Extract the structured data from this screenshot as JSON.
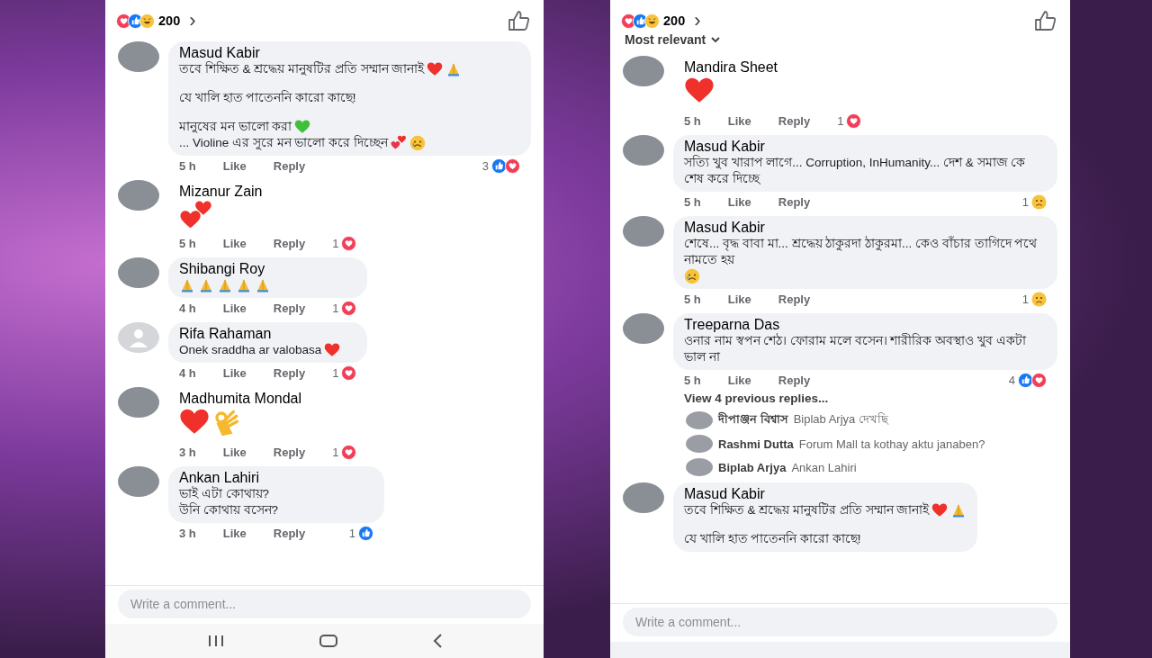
{
  "panels": [
    {
      "header": {
        "reactions": [
          {
            "kind": "love"
          },
          {
            "kind": "like"
          },
          {
            "kind": "haha"
          }
        ],
        "count": "200",
        "chevron": "›"
      },
      "comments": [
        {
          "author": "Masud Kabir",
          "bubble": true,
          "paragraphs": [
            [
              {
                "kind": "text",
                "text": "তবে শিক্ষিত & শ্রদ্ধেয় মানুষটির প্রতি সম্মান জানাই"
              },
              {
                "kind": "heart"
              },
              {
                "kind": "pray"
              }
            ],
            [
              {
                "kind": "text",
                "text": "যে খালি হাত পাতেননি কারো কাছে!"
              }
            ],
            [
              {
                "kind": "text",
                "text": "মানুষের মন ভালো করা"
              },
              {
                "kind": "green_heart"
              },
              {
                "kind": "text",
                "text": "... Violine এর সুরে মন ভালো করে দিচ্ছেন"
              },
              {
                "kind": "hearts"
              },
              {
                "kind": "sad"
              }
            ]
          ],
          "time": "5 h",
          "like": "Like",
          "reply": "Reply",
          "reactions": {
            "count": "3",
            "kinds": [
              {
                "kind": "like"
              },
              {
                "kind": "love"
              }
            ]
          }
        },
        {
          "author": "Mizanur Zain",
          "bubble": false,
          "paragraphs": [
            [
              {
                "kind": "hearts_big"
              }
            ]
          ],
          "time": "5 h",
          "like": "Like",
          "reply": "Reply",
          "reactions": {
            "count": "1",
            "kinds": [
              {
                "kind": "love"
              }
            ]
          }
        },
        {
          "author": "Shibangi Roy",
          "bubble": true,
          "paragraphs": [
            [
              {
                "kind": "pray"
              },
              {
                "kind": "pray"
              },
              {
                "kind": "pray"
              },
              {
                "kind": "pray"
              },
              {
                "kind": "pray"
              }
            ]
          ],
          "time": "4 h",
          "like": "Like",
          "reply": "Reply",
          "reactions": {
            "count": "1",
            "kinds": [
              {
                "kind": "love"
              }
            ]
          }
        },
        {
          "author": "Rifa Rahaman",
          "default_avatar": true,
          "bubble": true,
          "paragraphs": [
            [
              {
                "kind": "text",
                "text": "Onek sraddha ar valobasa"
              },
              {
                "kind": "heart"
              }
            ]
          ],
          "time": "4 h",
          "like": "Like",
          "reply": "Reply",
          "reactions": {
            "count": "1",
            "kinds": [
              {
                "kind": "love"
              }
            ]
          }
        },
        {
          "author": "Madhumita Mondal",
          "bubble": false,
          "paragraphs": [
            [
              {
                "kind": "heart_big"
              },
              {
                "kind": "ok_big"
              }
            ]
          ],
          "time": "3 h",
          "like": "Like",
          "reply": "Reply",
          "reactions": {
            "count": "1",
            "kinds": [
              {
                "kind": "love"
              }
            ]
          }
        },
        {
          "author": "Ankan Lahiri",
          "bubble": true,
          "paragraphs": [
            [
              {
                "kind": "text",
                "text": "ভাই এটা কোথায়?"
              },
              {
                "kind": "break"
              },
              {
                "kind": "text",
                "text": "উনি কোথায় বসেন?"
              }
            ]
          ],
          "time": "3 h",
          "like": "Like",
          "reply": "Reply",
          "reactions": {
            "count": "1",
            "kinds": [
              {
                "kind": "like"
              }
            ]
          }
        }
      ],
      "composer": {
        "placeholder": "Write a comment..."
      },
      "nav_bar": true
    },
    {
      "header": {
        "reactions": [
          {
            "kind": "love"
          },
          {
            "kind": "like"
          },
          {
            "kind": "haha"
          }
        ],
        "count": "200",
        "chevron": "›"
      },
      "sort_label": "Most relevant",
      "comments": [
        {
          "author": "Mandira Sheet",
          "bubble": false,
          "paragraphs": [
            [
              {
                "kind": "heart_big"
              }
            ]
          ],
          "time": "5 h",
          "like": "Like",
          "reply": "Reply",
          "reactions": {
            "count": "1",
            "kinds": [
              {
                "kind": "love"
              }
            ]
          }
        },
        {
          "author": "Masud Kabir",
          "bubble": true,
          "paragraphs": [
            [
              {
                "kind": "text",
                "text": "সত্যি খুব খারাপ লাগে... Corruption, InHumanity... দেশ & সমাজ কে শেষ করে দিচ্ছে"
              }
            ]
          ],
          "time": "5 h",
          "like": "Like",
          "reply": "Reply",
          "reactions": {
            "count": "1",
            "kinds": [
              {
                "kind": "sad"
              }
            ]
          }
        },
        {
          "author": "Masud Kabir",
          "bubble": true,
          "paragraphs": [
            [
              {
                "kind": "text",
                "text": "শেষে... বৃদ্ধ বাবা মা... শ্রদ্ধেয় ঠাকুরদা ঠাকুরমা... কেও বাঁচার তাগিদে পথে নামতে হয়"
              },
              {
                "kind": "sad"
              }
            ]
          ],
          "time": "5 h",
          "like": "Like",
          "reply": "Reply",
          "reactions": {
            "count": "1",
            "kinds": [
              {
                "kind": "sad"
              }
            ]
          }
        },
        {
          "author": "Treeparna Das",
          "bubble": true,
          "paragraphs": [
            [
              {
                "kind": "text",
                "text": "ওনার নাম স্বপন শেঠ। ফোরাম মলে বসেন। শারীরিক অবস্থাও খুব একটা ভাল না"
              }
            ]
          ],
          "time": "5 h",
          "like": "Like",
          "reply": "Reply",
          "reactions": {
            "count": "4",
            "kinds": [
              {
                "kind": "like"
              },
              {
                "kind": "love"
              }
            ]
          },
          "replies": {
            "view_more": "View 4 previous replies...",
            "items": [
              {
                "author": "দীপাঞ্জন বিশ্বাস",
                "text": "Biplab Arjya দেখছি"
              },
              {
                "author": "Rashmi Dutta",
                "text": "Forum Mall ta kothay aktu janaben?"
              },
              {
                "author": "Biplab Arjya",
                "text": "Ankan Lahiri"
              }
            ]
          }
        },
        {
          "author": "Masud Kabir",
          "bubble": true,
          "paragraphs": [
            [
              {
                "kind": "text",
                "text": "তবে শিক্ষিত & শ্রদ্ধেয় মানুষটির প্রতি সম্মান জানাই"
              },
              {
                "kind": "heart"
              },
              {
                "kind": "pray"
              }
            ],
            [
              {
                "kind": "text",
                "text": "যে খালি হাত পাতেননি কারো কাছে!"
              }
            ]
          ]
        }
      ],
      "composer": {
        "placeholder": "Write a comment..."
      },
      "nav_bar": false
    }
  ]
}
